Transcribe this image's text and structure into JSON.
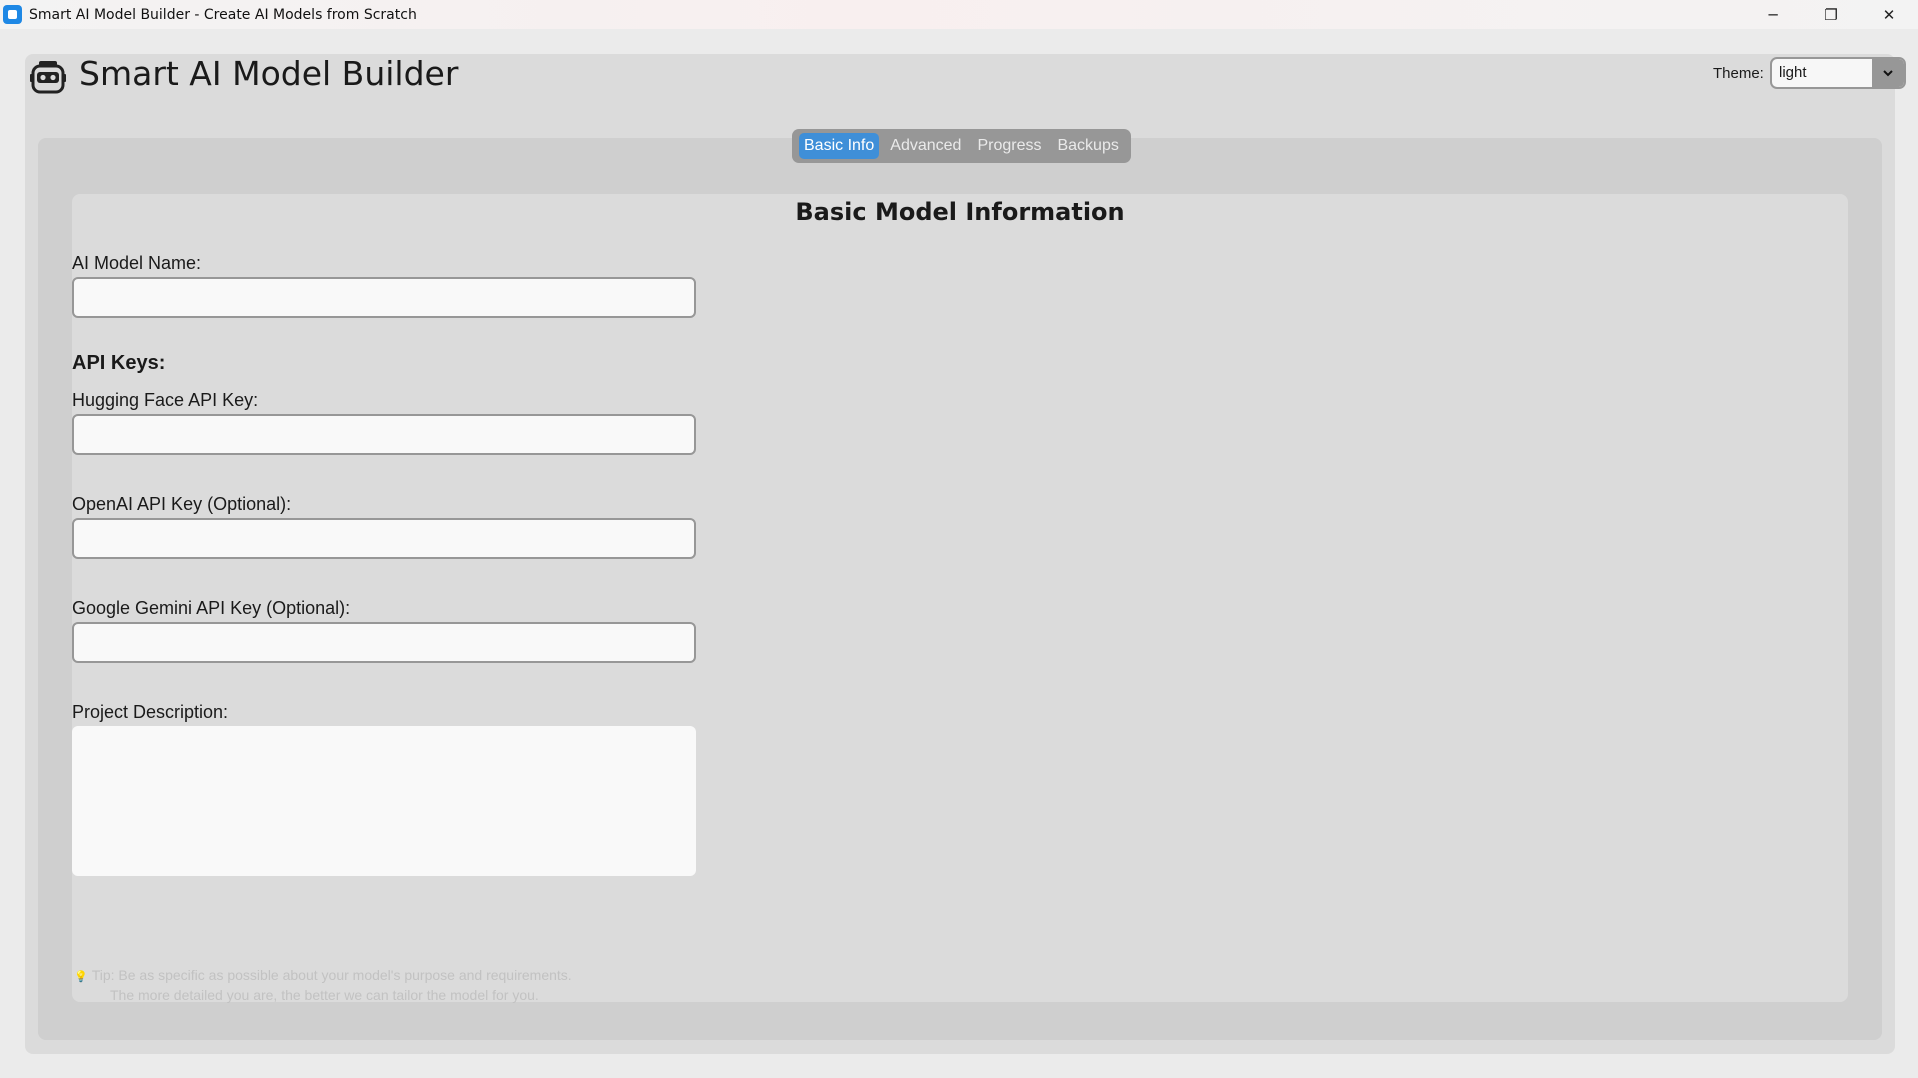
{
  "window": {
    "title": "Smart AI Model Builder - Create AI Models from Scratch",
    "controls": {
      "minimize": "─",
      "restore": "❐",
      "close": "✕"
    }
  },
  "header": {
    "icon": "robot-icon",
    "title": "Smart AI Model Builder",
    "theme_label": "Theme:",
    "theme_value": "light"
  },
  "tabs": [
    {
      "label": "Basic Info",
      "active": true
    },
    {
      "label": "Advanced",
      "active": false
    },
    {
      "label": "Progress",
      "active": false
    },
    {
      "label": "Backups",
      "active": false
    }
  ],
  "form": {
    "section_title": "Basic Model Information",
    "model_name_label": "AI Model Name:",
    "model_name_value": "",
    "api_keys_heading": "API Keys:",
    "hf_label": "Hugging Face API Key:",
    "hf_value": "",
    "openai_label": "OpenAI API Key (Optional):",
    "openai_value": "",
    "gemini_label": "Google Gemini API Key (Optional):",
    "gemini_value": "",
    "description_label": "Project Description:",
    "description_value": "",
    "tip_icon": "lightbulb-icon",
    "tip_line1": "Tip: Be as specific as possible about your model's purpose and requirements.",
    "tip_line2": "The more detailed you are, the better we can tailor the model for you."
  },
  "colors": {
    "accent": "#3f8fd8",
    "frame_bg": "#dbdbdb",
    "panel_bg": "#cfcfcf",
    "tab_bar_bg": "#979797"
  }
}
